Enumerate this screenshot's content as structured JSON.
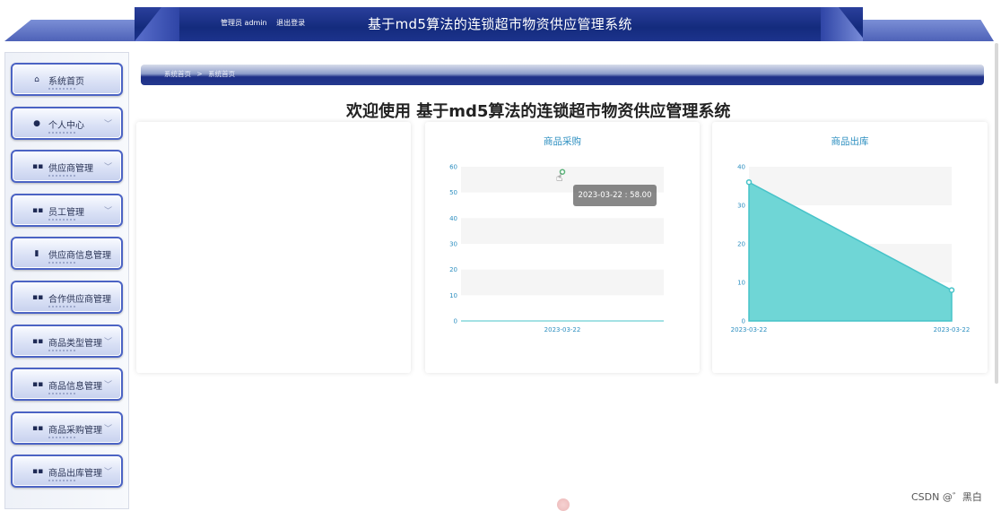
{
  "header": {
    "admin_text": "管理员 admin",
    "logout_text": "退出登录",
    "title": "基于md5算法的连锁超市物资供应管理系统"
  },
  "sidebar": {
    "items": [
      {
        "label": "系统首页",
        "icon": "home-icon",
        "has_arrow": false
      },
      {
        "label": "个人中心",
        "icon": "user-icon",
        "has_arrow": true
      },
      {
        "label": "供应商管理",
        "icon": "grid-icon",
        "has_arrow": true
      },
      {
        "label": "员工管理",
        "icon": "grid-icon",
        "has_arrow": true
      },
      {
        "label": "供应商信息管理",
        "icon": "book-icon",
        "has_arrow": false
      },
      {
        "label": "合作供应商管理",
        "icon": "grid-icon",
        "has_arrow": false
      },
      {
        "label": "商品类型管理",
        "icon": "grid-icon",
        "has_arrow": true
      },
      {
        "label": "商品信息管理",
        "icon": "grid-icon",
        "has_arrow": true
      },
      {
        "label": "商品采购管理",
        "icon": "grid-icon",
        "has_arrow": true
      },
      {
        "label": "商品出库管理",
        "icon": "grid-icon",
        "has_arrow": true
      }
    ]
  },
  "breadcrumb": {
    "home": "系统首页",
    "separator": ">",
    "current": "系统首页"
  },
  "welcome": "欢迎使用 基于md5算法的连锁超市物资供应管理系统",
  "tooltip": "2023-03-22 : 58.00",
  "watermark": "CSDN @゛黑白",
  "colors": {
    "accent": "#2d8fc0",
    "header": "#1a2f88",
    "area_fill": "#6fd6d6",
    "line": "#47c3c9"
  },
  "chart_data": [
    {
      "type": "line",
      "title": "商品采购",
      "x": [
        "2023-03-22"
      ],
      "y": [
        58
      ],
      "yticks": [
        0,
        10,
        20,
        30,
        40,
        50,
        60
      ],
      "ylim": [
        0,
        60
      ],
      "grid": true
    },
    {
      "type": "area",
      "title": "商品出库",
      "x": [
        "2023-03-22",
        "2023-03-22"
      ],
      "y": [
        36,
        8
      ],
      "yticks": [
        0,
        10,
        20,
        30,
        40
      ],
      "ylim": [
        0,
        40
      ],
      "grid": true
    }
  ]
}
